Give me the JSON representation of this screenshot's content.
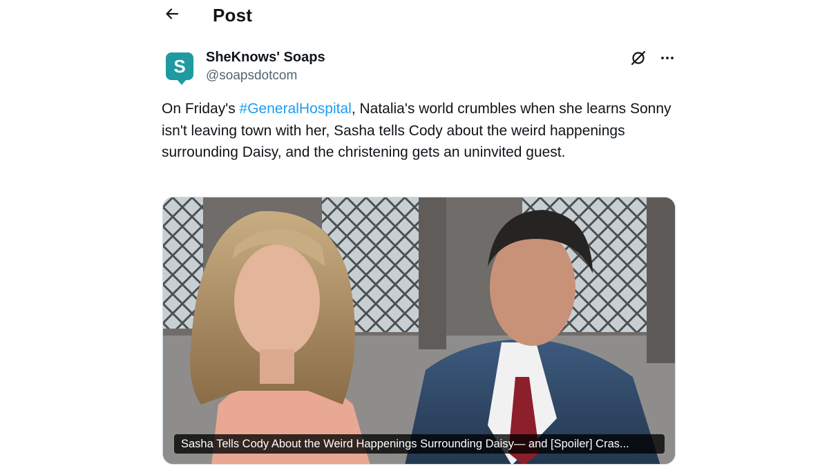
{
  "header": {
    "back_icon": "arrow-left-icon",
    "title": "Post"
  },
  "author": {
    "avatar_letter": "S",
    "avatar_color": "#1f9aa1",
    "display_name": "SheKnows' Soaps",
    "handle": "@soapsdotcom",
    "grok_icon": "grok-icon",
    "more_icon": "more-horizontal-icon"
  },
  "post": {
    "text_before": "On Friday's ",
    "hashtag": "#GeneralHospital",
    "text_after": ", Natalia's world crumbles when she learns Sonny isn't leaving town with her, Sasha tells Cody about the weird happenings surrounding Daisy, and the christening gets an uninvited guest.",
    "link_color": "#1d9bf0"
  },
  "media": {
    "caption": "Sasha Tells Cody About the Weird Happenings Surrounding Daisy— and [Spoiler] Cras..."
  }
}
